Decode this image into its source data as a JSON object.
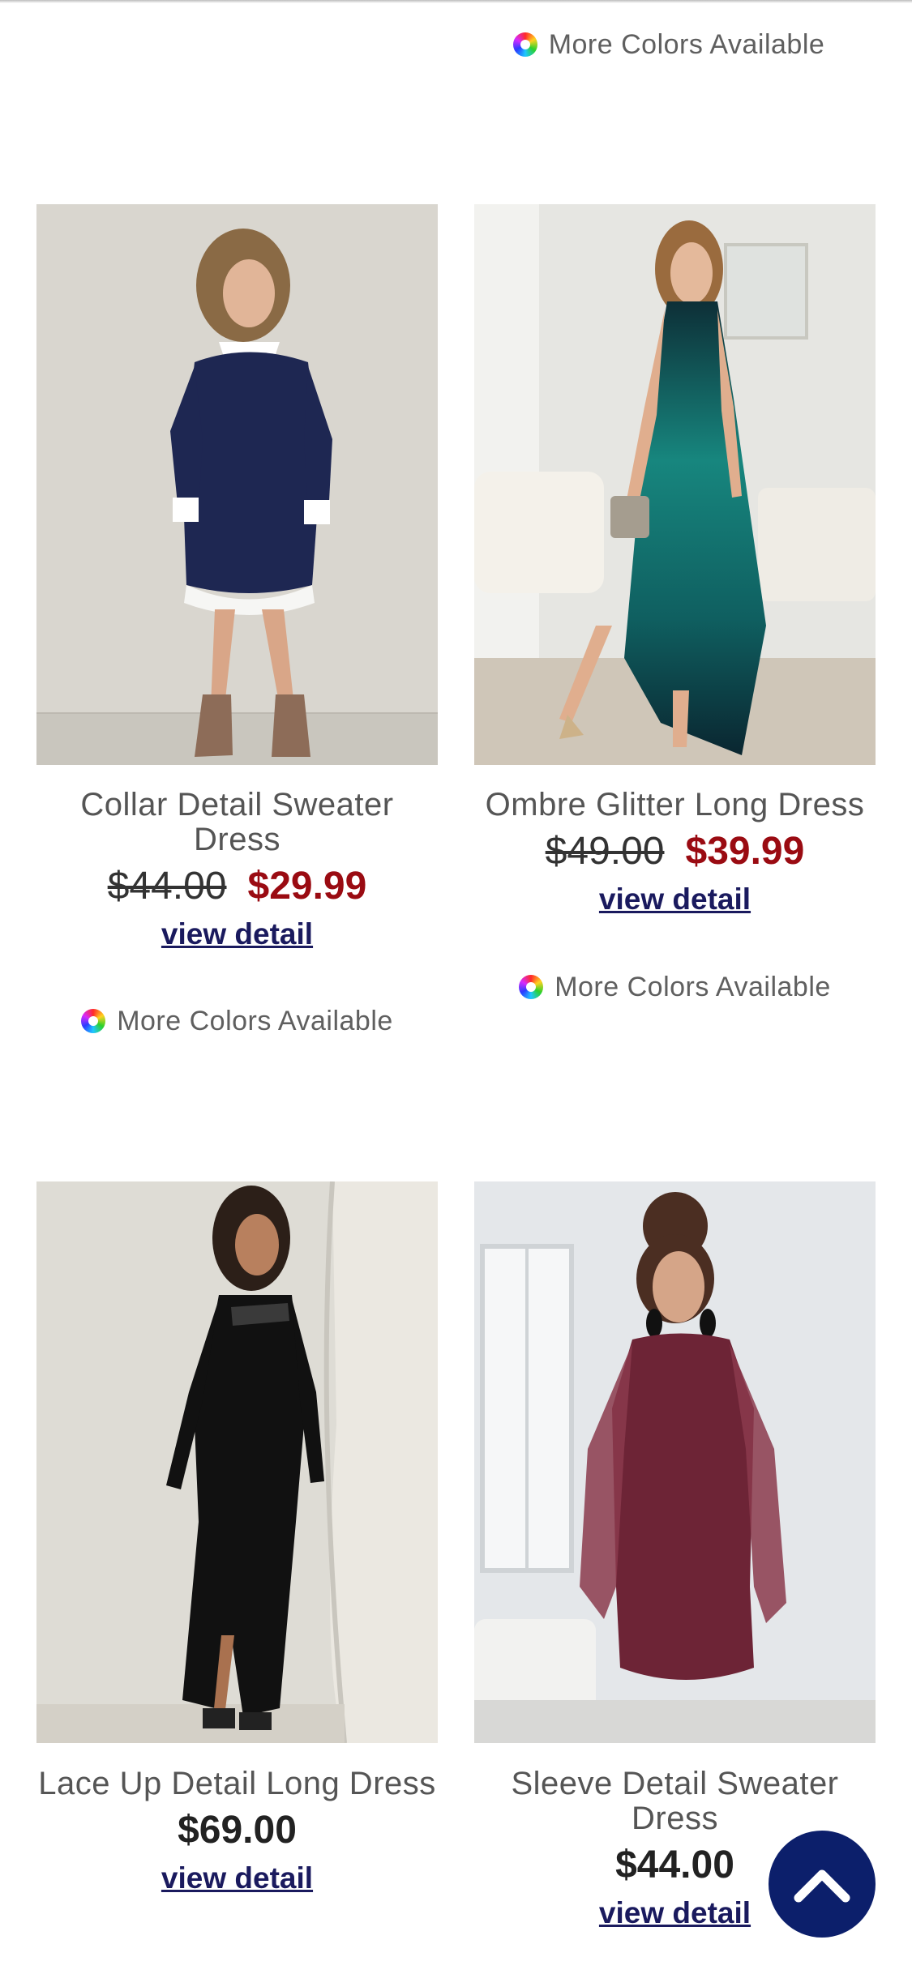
{
  "top_card": {
    "more_colors": "More Colors Available"
  },
  "products": [
    {
      "name": "Collar Detail Sweater Dress",
      "old_price": "$44.00",
      "price": "$29.99",
      "link": "view detail",
      "more_colors": "More Colors Available"
    },
    {
      "name": "Ombre Glitter Long Dress",
      "old_price": "$49.00",
      "price": "$39.99",
      "link": "view detail",
      "more_colors": "More Colors Available"
    },
    {
      "name": "Lace Up Detail Long Dress",
      "price": "$69.00",
      "link": "view detail"
    },
    {
      "name": "Sleeve Detail Sweater Dress",
      "price": "$44.00",
      "link": "view detail"
    }
  ],
  "icons": {
    "color_wheel": "color-wheel-icon",
    "scroll_top": "chevron-up-icon"
  },
  "colors": {
    "sale_price": "#9a0b12",
    "link": "#1a1a5e",
    "scroll_button": "#0c1f6b"
  }
}
